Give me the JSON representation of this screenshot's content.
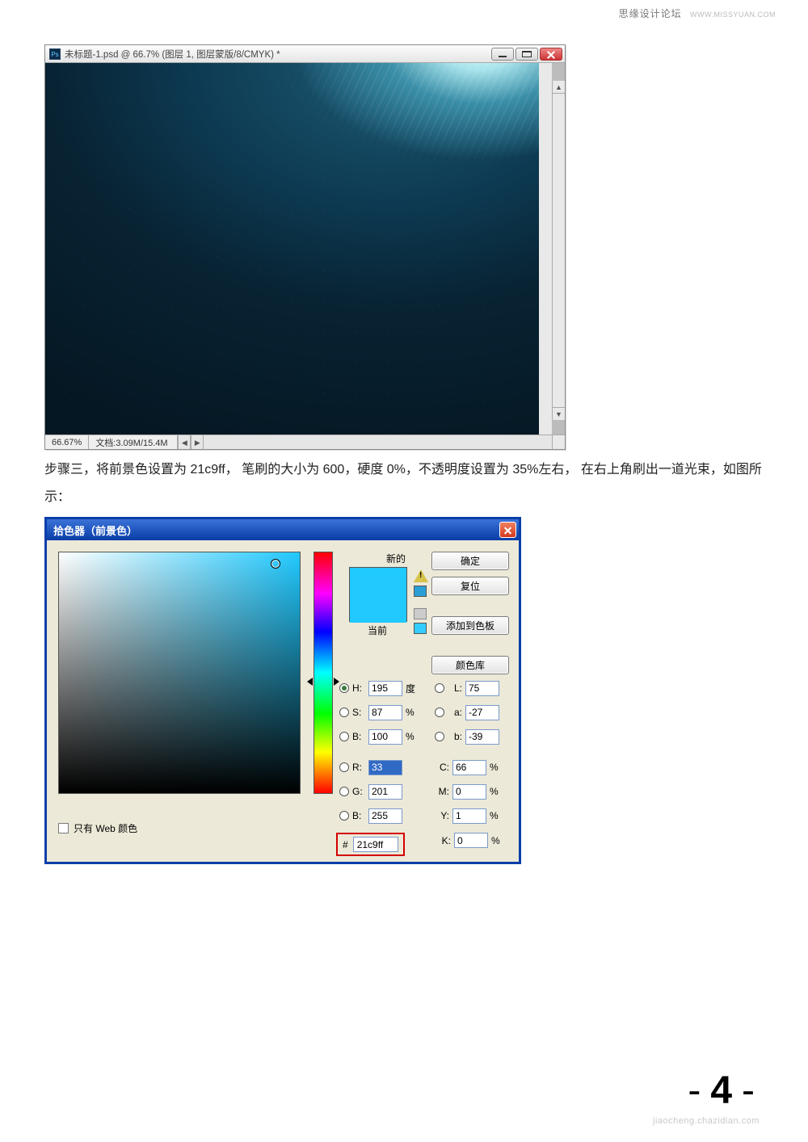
{
  "watermark": {
    "site": "思缘设计论坛",
    "url": "WWW.MISSYUAN.COM"
  },
  "ps_window": {
    "title": "未标题-1.psd @ 66.7% (图层 1, 图层蒙版/8/CMYK) *",
    "zoom": "66.67%",
    "doc_info": "文档:3.09M/15.4M"
  },
  "instruction": "步骤三，将前景色设置为 21c9ff，  笔刷的大小为 600，硬度 0%，不透明度设置为 35%左右，  在右上角刷出一道光束，如图所示：",
  "picker": {
    "title": "拾色器（前景色）",
    "new_label": "新的",
    "current_label": "当前",
    "buttons": {
      "ok": "确定",
      "reset": "复位",
      "add": "添加到色板",
      "lib": "颜色库"
    },
    "hsb": {
      "H": {
        "label": "H:",
        "value": "195",
        "unit": "度"
      },
      "S": {
        "label": "S:",
        "value": "87",
        "unit": "%"
      },
      "B": {
        "label": "B:",
        "value": "100",
        "unit": "%"
      }
    },
    "lab": {
      "L": {
        "label": "L:",
        "value": "75"
      },
      "a": {
        "label": "a:",
        "value": "-27"
      },
      "b": {
        "label": "b:",
        "value": "-39"
      }
    },
    "rgb": {
      "R": {
        "label": "R:",
        "value": "33"
      },
      "G": {
        "label": "G:",
        "value": "201"
      },
      "B": {
        "label": "B:",
        "value": "255"
      }
    },
    "cmyk": {
      "C": {
        "label": "C:",
        "value": "66",
        "unit": "%"
      },
      "M": {
        "label": "M:",
        "value": "0",
        "unit": "%"
      },
      "Y": {
        "label": "Y:",
        "value": "1",
        "unit": "%"
      },
      "K": {
        "label": "K:",
        "value": "0",
        "unit": "%"
      }
    },
    "hex": {
      "hash": "#",
      "value": "21c9ff"
    },
    "web_only": "只有 Web 颜色"
  },
  "page": {
    "number": "4",
    "dash": "-"
  },
  "footer_wm": "jiaocheng.chazidian.com"
}
